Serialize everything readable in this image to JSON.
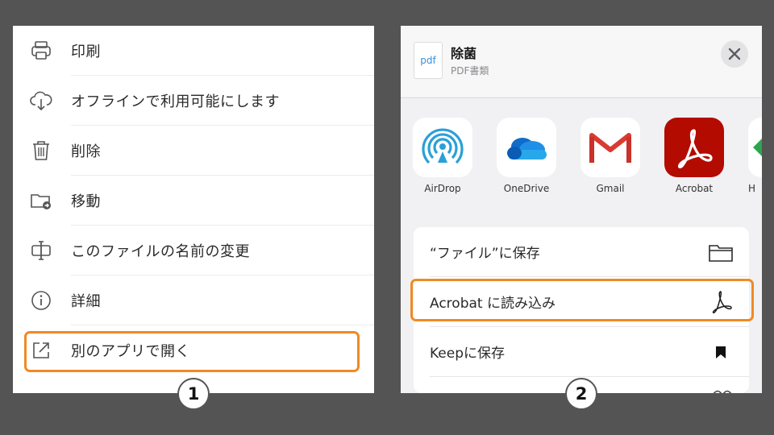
{
  "left_menu": {
    "items": [
      {
        "label": "印刷",
        "icon": "printer-icon"
      },
      {
        "label": "オフラインで利用可能にします",
        "icon": "cloud-download-icon"
      },
      {
        "label": "削除",
        "icon": "trash-icon"
      },
      {
        "label": "移動",
        "icon": "folder-move-icon"
      },
      {
        "label": "このファイルの名前の変更",
        "icon": "rename-icon"
      },
      {
        "label": "詳細",
        "icon": "info-icon"
      },
      {
        "label": "別のアプリで開く",
        "icon": "external-open-icon"
      }
    ]
  },
  "share_sheet": {
    "file_name": "除菌",
    "file_type": "PDF書類",
    "thumb_label": "pdf",
    "apps": [
      {
        "label": "AirDrop",
        "icon": "airdrop-icon"
      },
      {
        "label": "OneDrive",
        "icon": "onedrive-icon"
      },
      {
        "label": "Gmail",
        "icon": "gmail-icon"
      },
      {
        "label": "Acrobat",
        "icon": "acrobat-icon"
      },
      {
        "label": "H",
        "icon": "partial-app-icon"
      }
    ],
    "actions": [
      {
        "label": "“ファイル”に保存",
        "icon": "folder-icon"
      },
      {
        "label": "Acrobat に読み込み",
        "icon": "acrobat-logo-icon"
      },
      {
        "label": "Keepに保存",
        "icon": "bookmark-icon"
      }
    ]
  },
  "steps": {
    "one": "1",
    "two": "2"
  },
  "colors": {
    "highlight": "#f08a24",
    "acrobat_red": "#b30b00",
    "background": "#545454"
  }
}
